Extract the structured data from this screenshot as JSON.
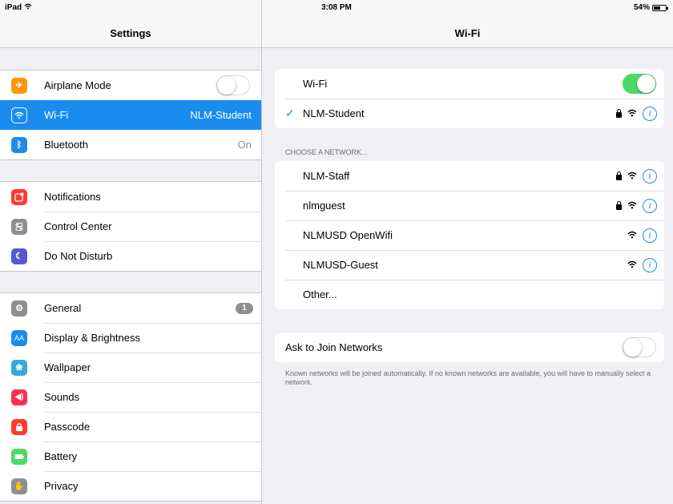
{
  "status_bar": {
    "device": "iPad",
    "time": "3:08 PM",
    "battery": "54%",
    "battery_fraction": 0.54
  },
  "settings": {
    "title": "Settings",
    "groups": [
      {
        "items": [
          {
            "label": "Airplane Mode",
            "icon": "airplane-icon",
            "color": "#ff9500",
            "toggle": false
          },
          {
            "label": "Wi-Fi",
            "icon": "wifi-icon",
            "color": "#1a8cf0",
            "value": "NLM-Student",
            "selected": true
          },
          {
            "label": "Bluetooth",
            "icon": "bluetooth-icon",
            "color": "#1a8cf0",
            "value": "On"
          }
        ]
      },
      {
        "items": [
          {
            "label": "Notifications",
            "icon": "notifications-icon",
            "color": "#ff3b30"
          },
          {
            "label": "Control Center",
            "icon": "control-center-icon",
            "color": "#8e8e93"
          },
          {
            "label": "Do Not Disturb",
            "icon": "moon-icon",
            "color": "#5856d6"
          }
        ]
      },
      {
        "items": [
          {
            "label": "General",
            "icon": "gear-icon",
            "color": "#8e8e93",
            "badge": "1"
          },
          {
            "label": "Display & Brightness",
            "icon": "display-icon",
            "color": "#1a8cf0"
          },
          {
            "label": "Wallpaper",
            "icon": "wallpaper-icon",
            "color": "#34aadc"
          },
          {
            "label": "Sounds",
            "icon": "speaker-icon",
            "color": "#ff2d55"
          },
          {
            "label": "Passcode",
            "icon": "lock-icon",
            "color": "#ff3b30"
          },
          {
            "label": "Battery",
            "icon": "battery-icon",
            "color": "#4cd964"
          },
          {
            "label": "Privacy",
            "icon": "hand-icon",
            "color": "#8e8e93"
          }
        ]
      }
    ]
  },
  "wifi": {
    "title": "Wi-Fi",
    "toggle_label": "Wi-Fi",
    "enabled": true,
    "connected": "NLM-Student",
    "choose_header": "CHOOSE A NETWORK...",
    "networks": [
      {
        "name": "NLM-Staff",
        "locked": true
      },
      {
        "name": "nlmguest",
        "locked": true
      },
      {
        "name": "NLMUSD OpenWifi",
        "locked": false
      },
      {
        "name": "NLMUSD-Guest",
        "locked": false
      },
      {
        "name": "Other..."
      }
    ],
    "ask_to_join": {
      "label": "Ask to Join Networks",
      "enabled": false
    },
    "footer": "Known networks will be joined automatically. If no known networks are available, you will have to manually select a network."
  }
}
